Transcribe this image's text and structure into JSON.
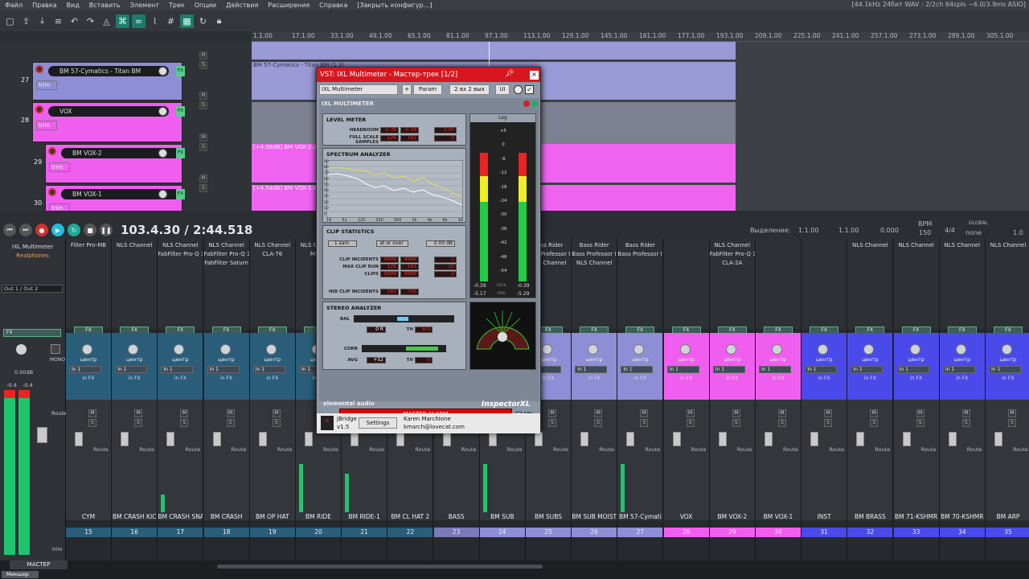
{
  "menubar": {
    "items": [
      "Файл",
      "Правка",
      "Вид",
      "Вставить",
      "Элемент",
      "Трек",
      "Опции",
      "Действия",
      "Расширения",
      "Справка",
      "[Закрыть конфигур...]"
    ],
    "status": "[44.1kHz 24бит WAV : 2/2ch 64spls ~6.0/3.9ms ASIO]"
  },
  "ruler": {
    "marks": [
      "1.1.00",
      "17.1.00",
      "33.1.00",
      "49.1.00",
      "65.1.00",
      "81.1.00",
      "97.1.00",
      "113.1.00",
      "129.1.00",
      "145.1.00",
      "161.1.00",
      "177.1.00",
      "193.1.00",
      "209.1.00",
      "225.1.00",
      "241.1.00",
      "257.1.00",
      "273.1.00",
      "289.1.00",
      "305.1.00"
    ]
  },
  "tracks": [
    {
      "num": "27",
      "name": "BM 57-Cymatics - Titan BM",
      "color": "#8e8ed6"
    },
    {
      "num": "28",
      "name": "VOX",
      "color": "#f05ef0"
    },
    {
      "num": "29",
      "name": "BM VOX-2",
      "color": "#f05ef0"
    },
    {
      "num": "30",
      "name": "BM VOX-1",
      "color": "#f05ef0"
    }
  ],
  "track_btn": {
    "trim": "trim",
    "fx": "FX",
    "m": "M",
    "s": "S"
  },
  "items": {
    "titan": "BM 57-Cymatics - Titan BM (1 3)",
    "vox2": "[+4.06dB] BM VOX-2.wav",
    "vox1": "[+4.54dB] BM VOX-1.wav"
  },
  "transport": {
    "time": "103.4.30 / 2:44.518",
    "sel_label": "Выделение:",
    "sel_start": "1.1.00",
    "sel_end": "1.1.00",
    "sel_len": "0.000",
    "bpm_label": "BPM",
    "bpm": "150",
    "sig": "4/4",
    "global": "GLOBAL",
    "none": "none",
    "rate": "1.0"
  },
  "mixer": {
    "master_fx": "IXL Multimeter",
    "master_fx2": "Realphones",
    "master_out": "Out 1 / Out 2",
    "master_label": "МАСТЕР",
    "master_db": "0.00dB",
    "mono": "MONO",
    "trim": "trim",
    "db": [
      "-0.4",
      "-0.4"
    ],
    "pan": "центр",
    "in": "In 1",
    "infx": "in FX",
    "route": "Route",
    "fx": "FX",
    "m": "M",
    "s": "S",
    "strips": [
      {
        "name": "CYM",
        "num": "15",
        "color": "#2a5d7a",
        "fx": [
          "Filter Pro-MB"
        ]
      },
      {
        "name": "BM CRASH KIC",
        "num": "16",
        "color": "#2a5d7a",
        "fx": [
          "NLS Channel"
        ]
      },
      {
        "name": "BM CRASH SNA",
        "num": "17",
        "color": "#2a5d7a",
        "fx": [
          "NLS Channel",
          "FabFilter Pro-Q 3"
        ]
      },
      {
        "name": "BM CRASH",
        "num": "18",
        "color": "#2a5d7a",
        "fx": [
          "NLS Channel",
          "FabFilter Pro-Q 3",
          "FabFilter Saturn"
        ]
      },
      {
        "name": "BM OP HAT",
        "num": "19",
        "color": "#2a5d7a",
        "fx": [
          "NLS Channel",
          "CLA-76"
        ]
      },
      {
        "name": "BM RIDE",
        "num": "20",
        "color": "#2a5d7a",
        "fx": [
          "NLS Channel",
          "MSED"
        ]
      },
      {
        "name": "BM RIDE-1",
        "num": "21",
        "color": "#2a5d7a",
        "fx": []
      },
      {
        "name": "BM CL HAT 2",
        "num": "22",
        "color": "#2a5d7a",
        "fx": []
      },
      {
        "name": "BASS",
        "num": "23",
        "color": "#7a7ab8",
        "fx": []
      },
      {
        "name": "BM SUB",
        "num": "24",
        "color": "#8e8ed6",
        "fx": []
      },
      {
        "name": "BM SUBS",
        "num": "25",
        "color": "#8e8ed6",
        "fx": [
          "Bass Rider",
          "Bass Professor II",
          "NLS Channel"
        ]
      },
      {
        "name": "BM SUB MOIST",
        "num": "26",
        "color": "#8e8ed6",
        "fx": [
          "Bass Rider",
          "Bass Professor II",
          "NLS Channel"
        ]
      },
      {
        "name": "BM 57-Cymati",
        "num": "27",
        "color": "#8e8ed6",
        "fx": [
          "Bass Rider",
          "Bass Professor II"
        ]
      },
      {
        "name": "VOX",
        "num": "28",
        "color": "#f05ef0",
        "fx": []
      },
      {
        "name": "BM VOX-2",
        "num": "29",
        "color": "#f05ef0",
        "fx": [
          "NLS Channel",
          "FabFilter Pro-Q 3",
          "CLA-2A"
        ]
      },
      {
        "name": "BM VOX-1",
        "num": "30",
        "color": "#f05ef0",
        "fx": []
      },
      {
        "name": "INST",
        "num": "31",
        "color": "#4a4aea",
        "fx": []
      },
      {
        "name": "BM BRASS",
        "num": "32",
        "color": "#4a4aea",
        "fx": [
          "NLS Channel"
        ]
      },
      {
        "name": "BM 71-KSHMR",
        "num": "33",
        "color": "#4a4aea",
        "fx": [
          "NLS Channel"
        ]
      },
      {
        "name": "BM 70-KSHMR",
        "num": "34",
        "color": "#4a4aea",
        "fx": [
          "NLS Channel"
        ]
      },
      {
        "name": "BM ARP",
        "num": "35",
        "color": "#4a4aea",
        "fx": [
          "NLS Channel"
        ]
      }
    ]
  },
  "plugin": {
    "title": "VST: IXL Multimeter - Мастер-трек [1/2]",
    "preset": "IXL Multimeter",
    "plus": "+",
    "param": "Param",
    "io": "2 вх 2 вых",
    "ui": "UI",
    "header": "IXL MULTIMETER",
    "level_meter": "LEVEL METER",
    "headroom": "HEADROOM",
    "fss": "FULL SCALE SAMPLES",
    "hr_l": "-0.39",
    "hr_r": "-0.39",
    "hr_set": "3.00",
    "fss_l": "126",
    "fss_r": "161",
    "fss_set": "5",
    "log": "Log",
    "spectrum": "SPECTRUM ANALYZER",
    "spec_y": [
      "90",
      "80",
      "70",
      "60",
      "50",
      "40",
      "30",
      "20",
      "10",
      "0"
    ],
    "spec_x": [
      "16",
      "51",
      "125",
      "250",
      "500",
      "2k",
      "4k",
      "8k",
      "16"
    ],
    "clip_stats": "CLIP STATISTICS",
    "clip_mode": "1 sam",
    "clip_over": "at or over",
    "clip_db": "0.00 dB",
    "ci": "CLIP INCIDENTS",
    "mcr": "MAX CLIP RUN",
    "clips": "CLIPS",
    "hci": "HID CLIP INCIDENTS",
    "ci_l": "9999",
    "ci_r": "9999",
    "ci_set": "1",
    "mcr_l": "126",
    "mcr_r": "161",
    "mcr_set": "10",
    "cl_l": "9999",
    "cl_r": "9999",
    "cl_set": "2",
    "hci_l": "593",
    "hci_r": "702",
    "stereo": "STEREO ANALYZER",
    "bal": "BAL",
    "bal_lr": "0 R",
    "th": "TH",
    "th_val": "6.0",
    "corr": "CORR",
    "avg": "AVG",
    "avg_val": "+52",
    "th2": "0",
    "meter_scale": [
      "+5",
      "0",
      "-6",
      "-12",
      "-18",
      "-24",
      "-30",
      "-36",
      "-42",
      "-48",
      "-54"
    ],
    "peak_l": "-0.39",
    "peak_r": "-0.39",
    "rms_l": "-5.17",
    "rms_r": "-5.29",
    "peak": "PEAK",
    "rms": "RMS",
    "alarm": "MASTER ALARM",
    "sev": "SEV",
    "brand": "elemental audio",
    "inspector": "InspectorXL",
    "jbridge": "jBridge",
    "ver": "v1.5",
    "settings": "Settings",
    "author": "Karen Marchione",
    "email": "kmarch@lovecat.com"
  },
  "bottom": {
    "tab": "Микшер"
  }
}
